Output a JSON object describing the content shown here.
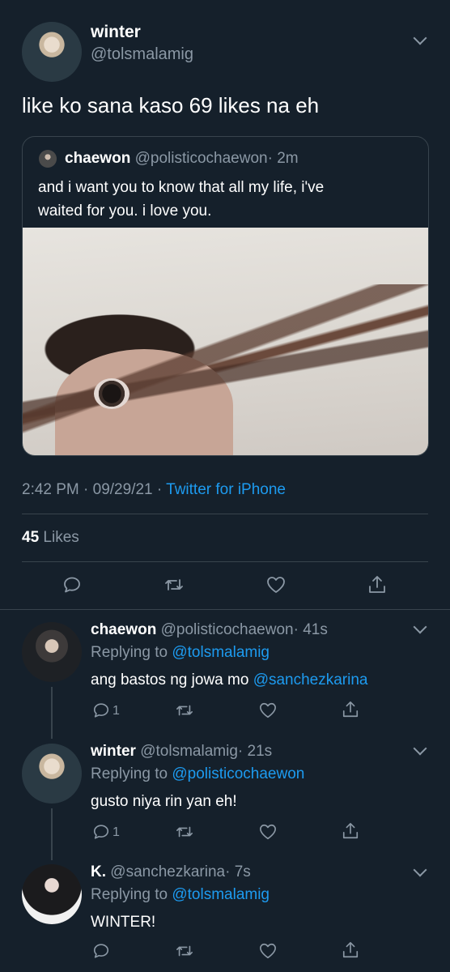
{
  "tweet": {
    "author": {
      "name": "winter",
      "handle": "@tolsmalamig"
    },
    "text": "like ko sana kaso 69 likes na eh",
    "quote": {
      "name": "chaewon",
      "handle": "@polisticochaewon",
      "time": "· 2m",
      "text_line1": "and i want you to know that all my life, i've",
      "text_line2": "waited for you. i love you."
    },
    "meta": {
      "time": "2:42 PM · 09/29/21 ·",
      "source": "Twitter for iPhone"
    },
    "likes": {
      "count": "45",
      "label": "Likes"
    },
    "actions": [
      "reply-icon",
      "retweet-icon",
      "like-icon",
      "share-icon"
    ]
  },
  "replies": [
    {
      "name": "chaewon",
      "handle": "@polisticochaewon",
      "time": "· 41s",
      "replying_prefix": "Replying to",
      "replying_to": "@tolsmalamig",
      "text": "ang bastos ng jowa mo",
      "mention": "@sanchezkarina",
      "reply_count": "1"
    },
    {
      "name": "winter",
      "handle": "@tolsmalamig",
      "time": "· 21s",
      "replying_prefix": "Replying to",
      "replying_to": "@polisticochaewon",
      "text": "gusto niya rin yan eh!",
      "mention": "",
      "reply_count": "1"
    },
    {
      "name": "K.",
      "handle": "@sanchezkarina",
      "time": "· 7s",
      "replying_prefix": "Replying to",
      "replying_to": "@tolsmalamig",
      "text": "WINTER!",
      "mention": "",
      "reply_count": ""
    }
  ],
  "colors": {
    "background": "#15202b",
    "link": "#1d9bf0",
    "muted": "#8b98a5",
    "divider": "#38444d"
  }
}
